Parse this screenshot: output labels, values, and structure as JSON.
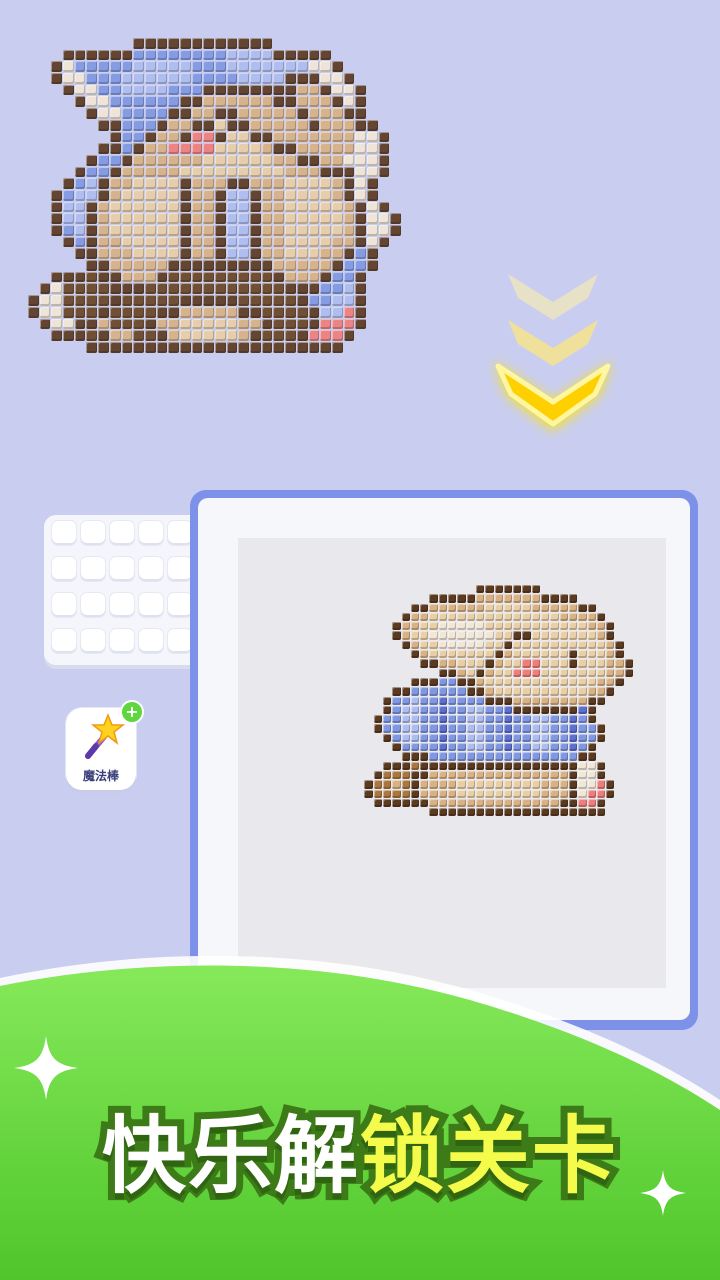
{
  "banner": {
    "title_part1": "快乐解",
    "title_part2": "锁关卡"
  },
  "boosters": {
    "magic_wand_label": "魔法棒",
    "magic_wand_icon": "magic-wand-icon",
    "add_icon": "plus-icon"
  },
  "colors": {
    "background": "#c9cdef",
    "frame": "#7d91e8",
    "banner_green": "#6ad840",
    "title_highlight": "#f4fb4a",
    "chevron": "#ffd400"
  }
}
